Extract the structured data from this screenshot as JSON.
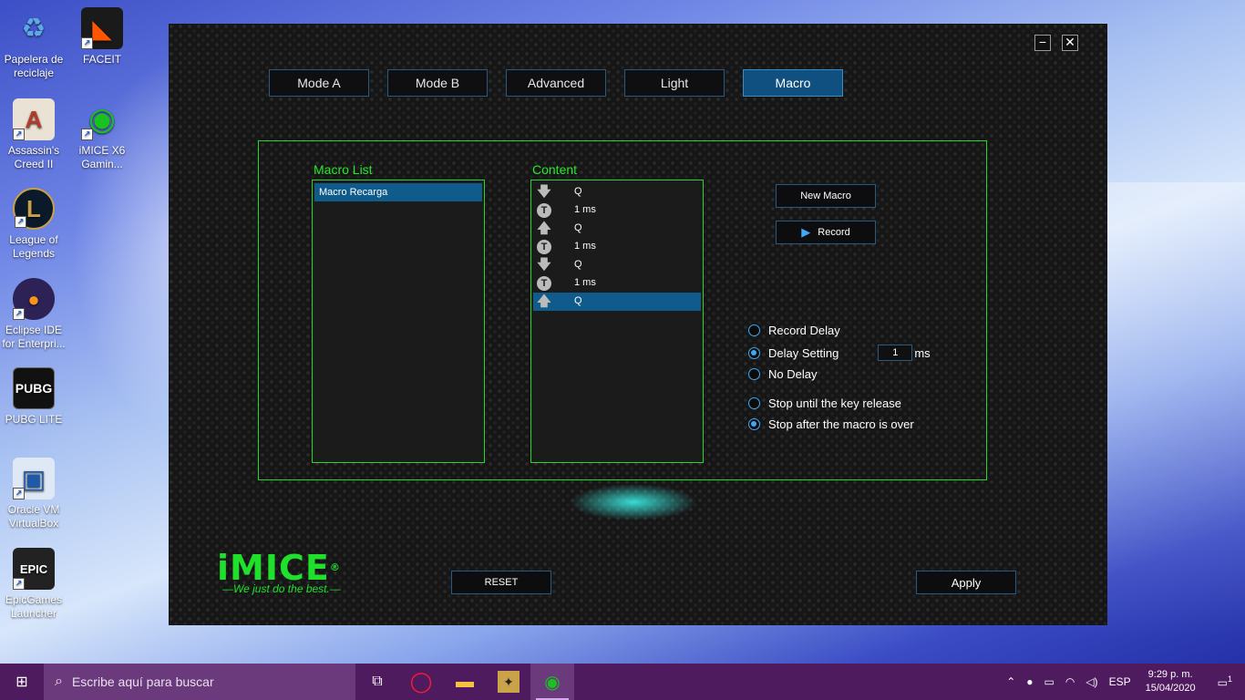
{
  "desktop": {
    "icons": [
      {
        "label": "Papelera de reciclaje",
        "glyph": "♻",
        "color": "#5fa8e8"
      },
      {
        "label": "FACEIT",
        "glyph": "◣",
        "color": "#ff5500"
      },
      {
        "label": "Assassin's Creed II",
        "glyph": "A",
        "color": "#b53a2a"
      },
      {
        "label": "iMICE X6 Gamin...",
        "glyph": "◉",
        "color": "#19c21f"
      },
      {
        "label": "League of Legends",
        "glyph": "L",
        "color": "#c8a04a"
      },
      {
        "label": "Eclipse IDE for Enterpri...",
        "glyph": "●",
        "color": "#2c2255"
      },
      {
        "label": "PUBG LITE",
        "glyph": "PUBG",
        "color": "#111111"
      },
      {
        "label": "Oracle VM VirtualBox",
        "glyph": "▣",
        "color": "#1e5aa8"
      },
      {
        "label": "EpicGames Launcher",
        "glyph": "EPIC",
        "color": "#222222"
      }
    ]
  },
  "app": {
    "window_controls": {
      "minimize": "−",
      "close": "✕"
    },
    "tabs": [
      {
        "label": "Mode A",
        "active": false
      },
      {
        "label": "Mode B",
        "active": false
      },
      {
        "label": "Advanced",
        "active": false
      },
      {
        "label": "Light",
        "active": false
      },
      {
        "label": "Macro",
        "active": true
      }
    ],
    "macro_list": {
      "title": "Macro List",
      "items": [
        "Macro Recarga"
      ]
    },
    "content": {
      "title": "Content",
      "rows": [
        {
          "icon": "arrow-down-icon",
          "glyph": "🡇",
          "value": "Q",
          "selected": false
        },
        {
          "icon": "timer-icon",
          "glyph": "T",
          "value": "1 ms",
          "selected": false
        },
        {
          "icon": "arrow-up-icon",
          "glyph": "🡅",
          "value": "Q",
          "selected": false
        },
        {
          "icon": "timer-icon",
          "glyph": "T",
          "value": "1 ms",
          "selected": false
        },
        {
          "icon": "arrow-down-icon",
          "glyph": "🡇",
          "value": "Q",
          "selected": false
        },
        {
          "icon": "timer-icon",
          "glyph": "T",
          "value": "1 ms",
          "selected": false
        },
        {
          "icon": "arrow-up-icon",
          "glyph": "🡅",
          "value": "Q",
          "selected": true
        }
      ]
    },
    "buttons": {
      "new_macro": "New Macro",
      "record": "Record",
      "reset": "RESET",
      "apply": "Apply"
    },
    "delay_options": {
      "record_delay": "Record Delay",
      "delay_setting": "Delay Setting",
      "delay_value": "1",
      "delay_unit": "ms",
      "no_delay": "No Delay",
      "selected": "delay_setting"
    },
    "stop_options": {
      "stop_key_release": "Stop until the key release",
      "stop_after_macro": "Stop after the macro is over",
      "selected": "stop_after_macro"
    },
    "logo": {
      "name": "iMICE",
      "registered": "®",
      "tagline": "—We just do the best.—"
    },
    "colors": {
      "accent_green": "#29d52a",
      "selection_blue": "#0f5c8c",
      "radio_blue": "#3fa9f5"
    }
  },
  "taskbar": {
    "search_placeholder": "Escribe aquí para buscar",
    "language": "ESP",
    "time": "9:29 p. m.",
    "date": "15/04/2020",
    "notification_count": "1",
    "apps": [
      "task-view",
      "opera",
      "file-explorer",
      "counter-strike",
      "imice"
    ]
  }
}
